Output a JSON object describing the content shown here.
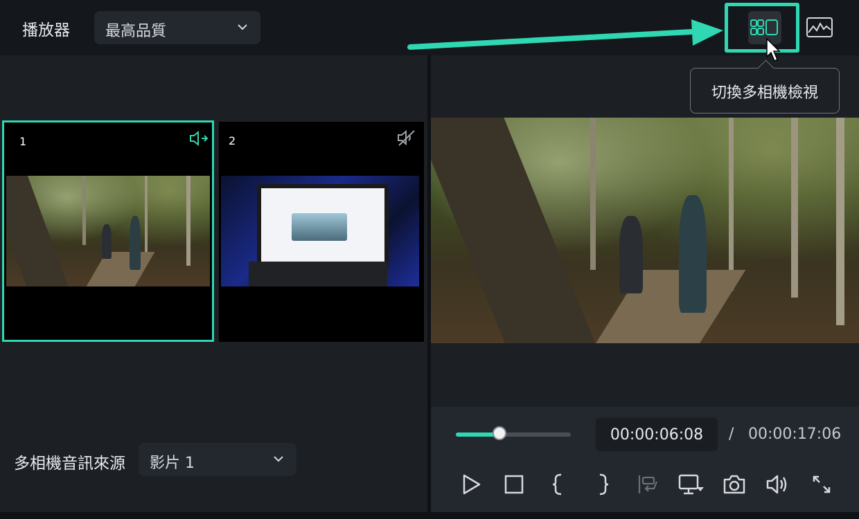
{
  "header": {
    "player_label": "播放器",
    "quality": {
      "selected": "最高品質"
    }
  },
  "toolbar": {
    "multicam_toggle": {
      "icon": "multicam-view-icon",
      "tooltip": "切換多相機檢視"
    },
    "waveform": {
      "icon": "waveform-icon"
    }
  },
  "cameras": [
    {
      "number": "1",
      "audio_icon": "audio-source-active-icon",
      "selected": true
    },
    {
      "number": "2",
      "audio_icon": "audio-muted-icon",
      "selected": false
    }
  ],
  "audio_source": {
    "label": "多相機音訊來源",
    "selected": "影片 1"
  },
  "playback": {
    "current_time": "00:00:06:08",
    "separator": "/",
    "total_time": "00:00:17:06",
    "progress": 0.38
  },
  "controls": [
    {
      "name": "play-icon"
    },
    {
      "name": "stop-icon"
    },
    {
      "name": "mark-in-icon"
    },
    {
      "name": "mark-out-icon"
    },
    {
      "name": "insert-to-timeline-icon"
    },
    {
      "name": "display-options-icon"
    },
    {
      "name": "snapshot-icon"
    },
    {
      "name": "volume-icon"
    },
    {
      "name": "fullscreen-icon"
    }
  ],
  "colors": {
    "accent": "#2fd8b2",
    "background": "#1c1f24",
    "topbar": "#14171c"
  }
}
